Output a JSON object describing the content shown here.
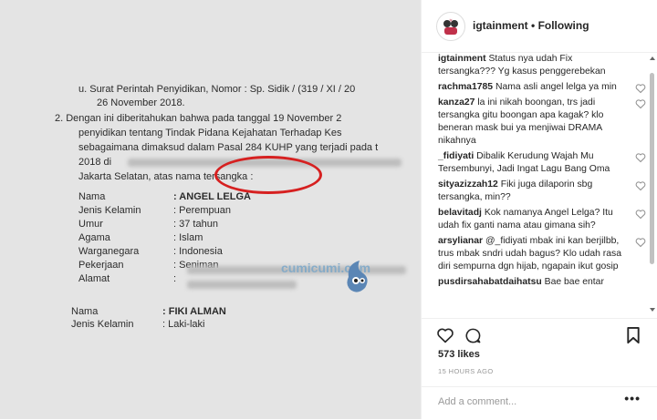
{
  "header": {
    "username": "igtainment",
    "separator": "•",
    "follow_status": "Following"
  },
  "document": {
    "line_u": "u. Surat Perintah Penyidikan, Nomor : Sp. Sidik / (319 / XI / 20",
    "line_date": "26   November 2018.",
    "line_2a": "2.   Dengan ini diberitahukan bahwa pada tanggal 19 November 2",
    "line_2b": "penyidikan tentang Tindak Pidana Kejahatan Terhadap Kes",
    "line_2c": "sebagaimana dimaksud dalam Pasal 284 KUHP yang terjadi pada t",
    "line_2d": "2018 di",
    "line_2e": "Jakarta Selatan, atas nama tersangka :",
    "fields": [
      {
        "label": "Nama",
        "value": ": ANGEL LELGA"
      },
      {
        "label": "Jenis Kelamin",
        "value": ": Perempuan"
      },
      {
        "label": "Umur",
        "value": ": 37 tahun"
      },
      {
        "label": "Agama",
        "value": ": Islam"
      },
      {
        "label": "Warganegara",
        "value": ": Indonesia"
      },
      {
        "label": "Pekerjaan",
        "value": ": Seniman"
      },
      {
        "label": "Alamat",
        "value": ":"
      }
    ],
    "fields2": [
      {
        "label": "Nama",
        "value": ": FIKI ALMAN"
      },
      {
        "label": "Jenis Kelamin",
        "value": ": Laki-laki"
      }
    ],
    "watermark": "cumicumi.com"
  },
  "comments": [
    {
      "user": "igtainment",
      "text": "Status nya udah Fix tersangka??? Yg kasus penggerebekan",
      "heart": false
    },
    {
      "user": "rachma1785",
      "text": "Nama asli angel lelga ya min",
      "heart": true
    },
    {
      "user": "kanza27",
      "text": "la ini nikah boongan, trs jadi tersangka gitu boongan apa kagak? klo beneran mask bui ya menjiwai DRAMA nikahnya",
      "heart": true
    },
    {
      "user": "_fidiyati",
      "text": "Dibalik Kerudung Wajah Mu Tersembunyi, Jadi Ingat Lagu Bang Oma",
      "heart": true
    },
    {
      "user": "sityazizzah12",
      "text": "Fiki juga dilaporin sbg tersangka, min??",
      "heart": true
    },
    {
      "user": "belavitadj",
      "text": "Kok namanya Angel Lelga? Itu udah fix ganti nama atau gimana sih?",
      "heart": true
    },
    {
      "user": "arsylianar",
      "text": "@_fidiyati mbak ini kan berjilbb, trus mbak sndri udah bagus? Klo udah rasa diri sempurna dgn hijab, ngapain ikut gosip",
      "heart": true
    },
    {
      "user": "pusdirsahabatdaihatsu",
      "text": "Bae bae entar",
      "heart": false
    }
  ],
  "likes": "573 likes",
  "timestamp": "15 HOURS AGO",
  "add_comment_placeholder": "Add a comment...",
  "more_label": "•••"
}
